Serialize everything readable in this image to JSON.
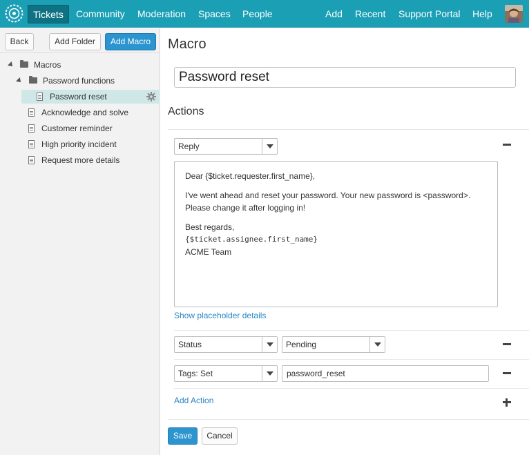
{
  "nav": {
    "logo_icon": "zendesk-ring-logo",
    "items": [
      "Tickets",
      "Community",
      "Moderation",
      "Spaces",
      "People"
    ],
    "right_items": [
      "Add",
      "Recent",
      "Support Portal",
      "Help"
    ],
    "active_item": "Tickets",
    "accent_color": "#1a9fb5"
  },
  "sidebar": {
    "back_label": "Back",
    "add_folder_label": "Add Folder",
    "add_macro_label": "Add Macro",
    "tree": [
      {
        "label": "Macros",
        "type": "folder",
        "expanded": true
      },
      {
        "label": "Password functions",
        "type": "folder",
        "expanded": true
      },
      {
        "label": "Password reset",
        "type": "macro",
        "selected": true
      },
      {
        "label": "Acknowledge and solve",
        "type": "macro"
      },
      {
        "label": "Customer reminder",
        "type": "macro"
      },
      {
        "label": "High priority incident",
        "type": "macro"
      },
      {
        "label": "Request more details",
        "type": "macro"
      }
    ]
  },
  "main": {
    "title": "Macro",
    "macro_name": "Password reset",
    "actions_heading": "Actions",
    "actions": [
      {
        "field": "Reply"
      },
      {
        "field": "Status",
        "value": "Pending"
      },
      {
        "field": "Tags: Set",
        "value": "password_reset"
      }
    ],
    "reply_body": {
      "greeting": "Dear {$ticket.requester.first_name},",
      "line1": "I've went ahead and reset your password. Your new password is <password>.",
      "line2": "Please change it after logging in!",
      "closing": "Best regards,",
      "signature_placeholder": "{$ticket.assignee.first_name}",
      "team": "ACME Team"
    },
    "show_placeholder_label": "Show placeholder details",
    "add_action_label": "Add Action",
    "save_label": "Save",
    "cancel_label": "Cancel"
  }
}
